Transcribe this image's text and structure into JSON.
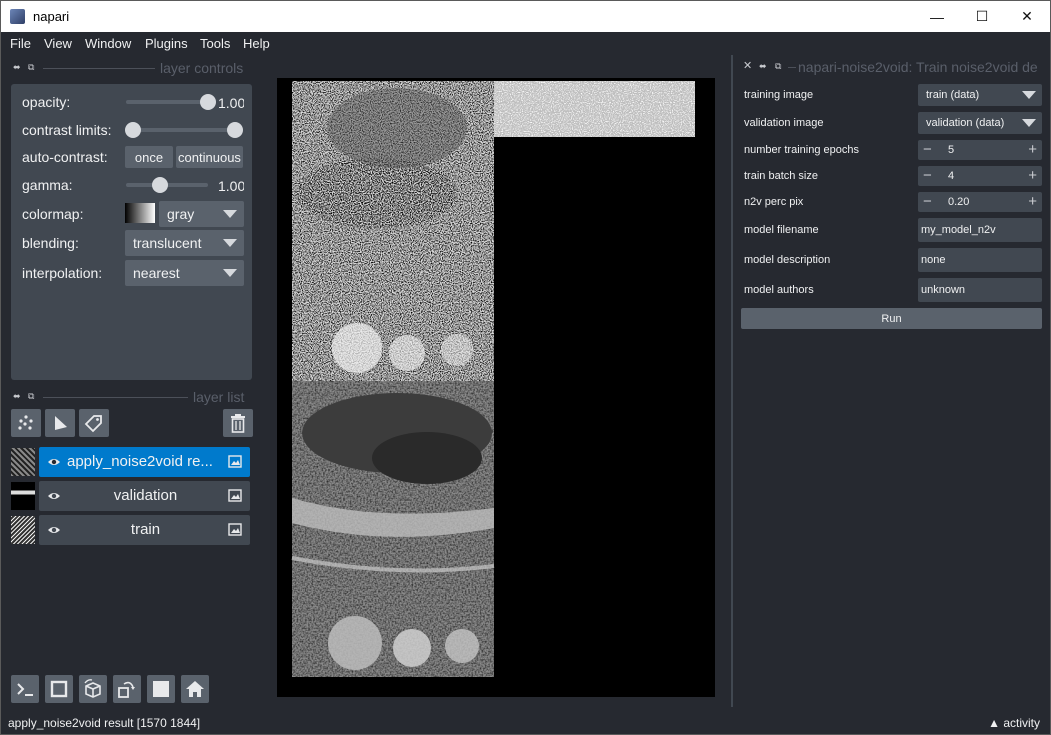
{
  "window": {
    "title": "napari",
    "minimize_glyph": "—",
    "maximize_glyph": "☐",
    "close_glyph": "✕"
  },
  "menu": [
    "File",
    "View",
    "Window",
    "Plugins",
    "Tools",
    "Help"
  ],
  "layer_controls": {
    "title": "layer controls",
    "opacity_label": "opacity:",
    "opacity_value": "1.00",
    "opacity": 1.0,
    "contrast_limits_label": "contrast limits:",
    "contrast_limits_range": [
      0.0,
      1.0
    ],
    "auto_contrast_label": "auto-contrast:",
    "once_label": "once",
    "continuous_label": "continuous",
    "gamma_label": "gamma:",
    "gamma_value": "1.00",
    "gamma_fraction": 0.42,
    "colormap_label": "colormap:",
    "colormap_value": "gray",
    "blending_label": "blending:",
    "blending_value": "translucent",
    "interpolation_label": "interpolation:",
    "interpolation_value": "nearest"
  },
  "layer_list": {
    "title": "layer list",
    "layers": [
      {
        "name": "apply_noise2void re...",
        "selected": true,
        "visible": true
      },
      {
        "name": "validation",
        "selected": false,
        "visible": true
      },
      {
        "name": "train",
        "selected": false,
        "visible": true
      }
    ]
  },
  "plugin": {
    "title": "napari-noise2void: Train noise2void de",
    "fields": {
      "training_image_label": "training image",
      "training_image_value": "train (data)",
      "validation_image_label": "validation image",
      "validation_image_value": "validation (data)",
      "epochs_label": "number training epochs",
      "epochs_value": "5",
      "batch_label": "train batch size",
      "batch_value": "4",
      "perc_label": "n2v perc pix",
      "perc_value": "0.20",
      "filename_label": "model filename",
      "filename_value": "my_model_n2v",
      "description_label": "model description",
      "description_value": "none",
      "authors_label": "model authors",
      "authors_value": "unknown"
    },
    "run_label": "Run"
  },
  "status": {
    "text": "apply_noise2void result [1570 1844]",
    "activity": "▲ activity"
  },
  "colors": {
    "background": "#262930",
    "panel": "#414851",
    "control": "#5a626c",
    "selected": "#007acc",
    "text": "#f0f1f2"
  }
}
